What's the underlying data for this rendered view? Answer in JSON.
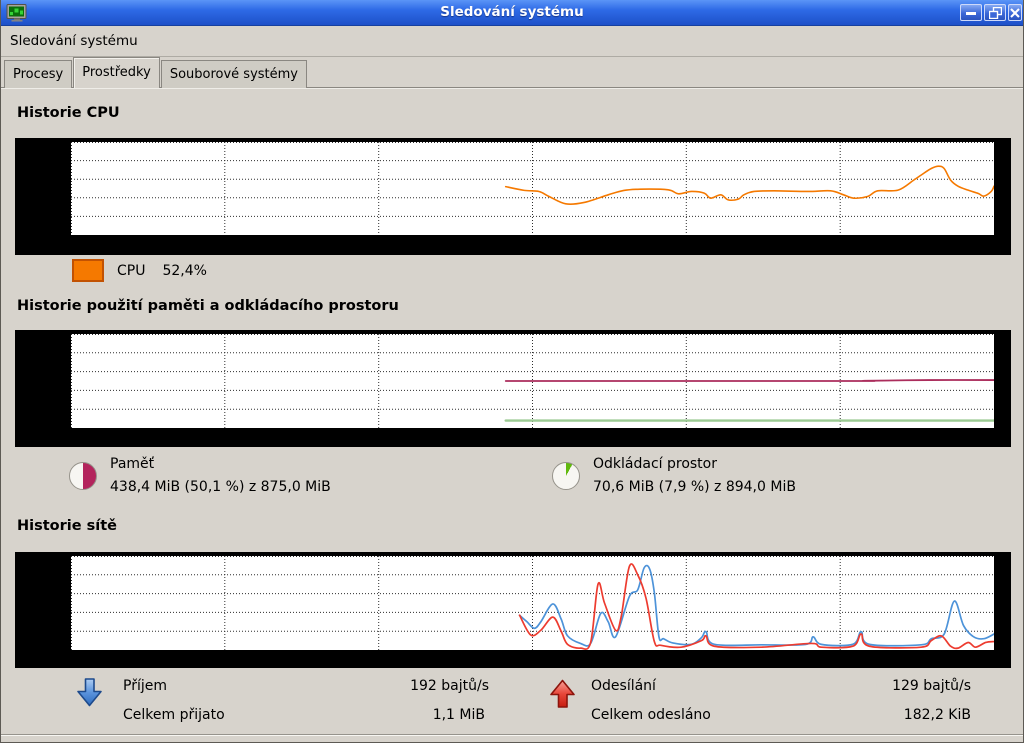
{
  "window": {
    "title": "Sledování systému"
  },
  "menu": {
    "app_menu": "Sledování systému"
  },
  "tabs": [
    {
      "label": "Procesy",
      "selected": false
    },
    {
      "label": "Prostředky",
      "selected": true
    },
    {
      "label": "Souborové systémy",
      "selected": false
    }
  ],
  "cpu": {
    "section_title": "Historie CPU",
    "legend": {
      "label": "CPU",
      "value": "52,4%",
      "color": "#f57900"
    }
  },
  "memory": {
    "section_title": "Historie použití paměti a odkládacího prostoru",
    "legend": {
      "label": "Paměť",
      "value": "438,4 MiB (50,1 %) z 875,0 MiB",
      "pie": {
        "percent": 50.1,
        "color": "#b3245c"
      }
    }
  },
  "swap": {
    "legend": {
      "label": "Odkládací prostor",
      "value": "70,6 MiB (7,9 %) z 894,0 MiB",
      "pie": {
        "percent": 7.9,
        "color": "#61b90e"
      }
    }
  },
  "network": {
    "section_title": "Historie sítě",
    "receive": {
      "label": "Příjem",
      "rate": "192 bajtů/s",
      "total_label": "Celkem přijato",
      "total": "1,1 MiB",
      "color": "#4d93d9"
    },
    "send": {
      "label": "Odesílání",
      "rate": "129 bajtů/s",
      "total_label": "Celkem odesláno",
      "total": "182,2 KiB",
      "color": "#ed3b2f"
    }
  },
  "chart_data": [
    {
      "id": "cpu-history",
      "type": "line",
      "title": "Historie CPU",
      "ylim": [
        0,
        100
      ],
      "grid": {
        "h_divisions": 5,
        "v_divisions": 6
      },
      "note": "y = CPU usage %, x = last 60 s; axis labels not visible (rendered black)",
      "series": [
        {
          "name": "CPU",
          "color": "#f57900",
          "width": 1.6,
          "current": 52.4,
          "points": [
            [
              0.471,
              52
            ],
            [
              0.491,
              48
            ],
            [
              0.507,
              46.8
            ],
            [
              0.518,
              41.4
            ],
            [
              0.536,
              33.5
            ],
            [
              0.556,
              35
            ],
            [
              0.582,
              43.2
            ],
            [
              0.599,
              47.9
            ],
            [
              0.617,
              49.3
            ],
            [
              0.647,
              48.6
            ],
            [
              0.658,
              44.3
            ],
            [
              0.672,
              46.8
            ],
            [
              0.686,
              45
            ],
            [
              0.693,
              39.6
            ],
            [
              0.704,
              43.2
            ],
            [
              0.712,
              37.8
            ],
            [
              0.723,
              38.6
            ],
            [
              0.729,
              43.2
            ],
            [
              0.74,
              46.8
            ],
            [
              0.762,
              47.5
            ],
            [
              0.798,
              46.8
            ],
            [
              0.823,
              47.5
            ],
            [
              0.837,
              43.2
            ],
            [
              0.848,
              39.6
            ],
            [
              0.863,
              41.4
            ],
            [
              0.874,
              47.5
            ],
            [
              0.896,
              48.2
            ],
            [
              0.913,
              59
            ],
            [
              0.921,
              64.4
            ],
            [
              0.932,
              71.5
            ],
            [
              0.94,
              74
            ],
            [
              0.946,
              71.5
            ],
            [
              0.953,
              59
            ],
            [
              0.961,
              52.5
            ],
            [
              0.972,
              48.2
            ],
            [
              0.983,
              44.6
            ],
            [
              0.989,
              41.8
            ],
            [
              0.997,
              46.8
            ],
            [
              1,
              52.4
            ]
          ]
        }
      ]
    },
    {
      "id": "memory-swap-history",
      "type": "line",
      "title": "Historie použití paměti a odkládacího prostoru",
      "ylim": [
        0,
        100
      ],
      "grid": {
        "h_divisions": 5,
        "v_divisions": 6
      },
      "series": [
        {
          "name": "Paměť",
          "color": "#ab2d5c",
          "width": 1.8,
          "current": 50.1,
          "points": [
            [
              0.471,
              50
            ],
            [
              0.84,
              50
            ],
            [
              0.86,
              50.2
            ],
            [
              0.93,
              51
            ],
            [
              1,
              51
            ]
          ]
        },
        {
          "name": "Odkládací prostor",
          "color": "#9ccb93",
          "width": 2.4,
          "current": 7.9,
          "points": [
            [
              0.471,
              7.9
            ],
            [
              1,
              7.9
            ]
          ]
        }
      ]
    },
    {
      "id": "network-history",
      "type": "line",
      "title": "Historie sítě",
      "ylim": [
        0,
        100
      ],
      "grid": {
        "h_divisions": 5,
        "v_divisions": 6
      },
      "note": "y scale relative (bytes/s), labels not visible",
      "series": [
        {
          "name": "Příjem",
          "color": "#4d93d9",
          "width": 1.7,
          "current_rate": "192 bajtů/s",
          "points": [
            [
              0.486,
              37
            ],
            [
              0.494,
              30
            ],
            [
              0.502,
              23
            ],
            [
              0.509,
              30
            ],
            [
              0.522,
              49
            ],
            [
              0.531,
              33
            ],
            [
              0.538,
              15
            ],
            [
              0.552,
              7
            ],
            [
              0.563,
              7
            ],
            [
              0.574,
              39
            ],
            [
              0.582,
              30
            ],
            [
              0.59,
              14
            ],
            [
              0.605,
              57
            ],
            [
              0.614,
              64
            ],
            [
              0.621,
              87.5
            ],
            [
              0.627,
              86
            ],
            [
              0.632,
              61
            ],
            [
              0.637,
              14
            ],
            [
              0.642,
              12
            ],
            [
              0.652,
              7.5
            ],
            [
              0.672,
              6
            ],
            [
              0.683,
              13
            ],
            [
              0.688,
              19.5
            ],
            [
              0.697,
              6
            ],
            [
              0.748,
              5.5
            ],
            [
              0.796,
              6
            ],
            [
              0.804,
              14
            ],
            [
              0.813,
              6
            ],
            [
              0.847,
              6
            ],
            [
              0.856,
              19.5
            ],
            [
              0.865,
              6
            ],
            [
              0.921,
              5.5
            ],
            [
              0.932,
              12
            ],
            [
              0.946,
              17
            ],
            [
              0.957,
              52
            ],
            [
              0.967,
              26
            ],
            [
              0.978,
              14
            ],
            [
              0.989,
              12
            ],
            [
              1,
              17
            ]
          ]
        },
        {
          "name": "Odesílání",
          "color": "#ed3b2f",
          "width": 1.7,
          "current_rate": "129 bajtů/s",
          "points": [
            [
              0.486,
              37
            ],
            [
              0.498,
              16
            ],
            [
              0.509,
              21
            ],
            [
              0.522,
              35
            ],
            [
              0.531,
              20
            ],
            [
              0.538,
              6
            ],
            [
              0.552,
              2
            ],
            [
              0.563,
              8
            ],
            [
              0.571,
              70
            ],
            [
              0.578,
              50
            ],
            [
              0.59,
              21
            ],
            [
              0.596,
              35
            ],
            [
              0.605,
              89
            ],
            [
              0.614,
              80
            ],
            [
              0.623,
              55
            ],
            [
              0.632,
              9
            ],
            [
              0.639,
              5
            ],
            [
              0.661,
              3
            ],
            [
              0.683,
              10
            ],
            [
              0.688,
              15
            ],
            [
              0.697,
              4
            ],
            [
              0.748,
              3
            ],
            [
              0.802,
              7
            ],
            [
              0.813,
              3
            ],
            [
              0.847,
              4
            ],
            [
              0.856,
              17
            ],
            [
              0.865,
              4
            ],
            [
              0.921,
              3
            ],
            [
              0.932,
              10
            ],
            [
              0.943,
              15
            ],
            [
              0.953,
              4
            ],
            [
              0.961,
              2
            ],
            [
              0.972,
              8
            ],
            [
              0.98,
              3
            ],
            [
              0.991,
              8
            ],
            [
              1,
              9
            ]
          ]
        }
      ]
    }
  ]
}
